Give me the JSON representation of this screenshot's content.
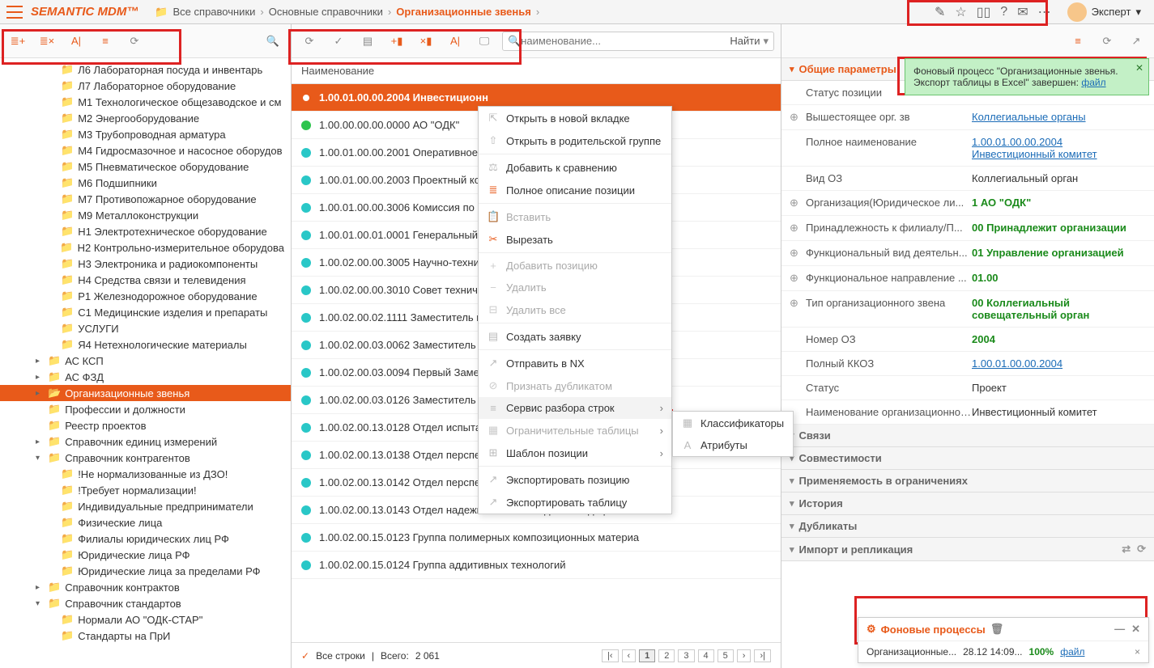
{
  "logo": "SEMANTIC MDM™",
  "breadcrumb": {
    "items": [
      "Все справочники",
      "Основные справочники",
      "Организационные звенья"
    ]
  },
  "user": {
    "name": "Эксперт"
  },
  "search": {
    "placeholder": "наименование...",
    "find": "Найти"
  },
  "tree": {
    "items": [
      {
        "lvl": 1,
        "label": "Л6 Лабораторная посуда и инвентарь"
      },
      {
        "lvl": 1,
        "label": "Л7 Лабораторное оборудование"
      },
      {
        "lvl": 1,
        "label": "М1 Технологическое общезаводское и см"
      },
      {
        "lvl": 1,
        "label": "М2 Энергооборудование"
      },
      {
        "lvl": 1,
        "label": "М3 Трубопроводная арматура"
      },
      {
        "lvl": 1,
        "label": "М4 Гидросмазочное и насосное оборудов"
      },
      {
        "lvl": 1,
        "label": "М5 Пневматическое оборудование"
      },
      {
        "lvl": 1,
        "label": "М6 Подшипники"
      },
      {
        "lvl": 1,
        "label": "М7 Противопожарное оборудование"
      },
      {
        "lvl": 1,
        "label": "М9 Металлоконструкции"
      },
      {
        "lvl": 1,
        "label": "Н1 Электротехническое оборудование"
      },
      {
        "lvl": 1,
        "label": "Н2 Контрольно-измерительное оборудова"
      },
      {
        "lvl": 1,
        "label": "Н3 Электроника и радиокомпоненты"
      },
      {
        "lvl": 1,
        "label": "Н4 Средства связи и телевидения"
      },
      {
        "lvl": 1,
        "label": "Р1 Железнодорожное оборудование"
      },
      {
        "lvl": 1,
        "label": "С1 Медицинские изделия и препараты"
      },
      {
        "lvl": 1,
        "label": "УСЛУГИ"
      },
      {
        "lvl": 1,
        "label": "Я4 Нетехнологические материалы"
      },
      {
        "lvl": 0,
        "label": "АС КСП",
        "arrow": true
      },
      {
        "lvl": 0,
        "label": "АС ФЗД",
        "arrow": true
      },
      {
        "lvl": 0,
        "label": "Организационные звенья",
        "arrow": true,
        "selected": true
      },
      {
        "lvl": 0,
        "label": "Профессии и должности"
      },
      {
        "lvl": 0,
        "label": "Реестр проектов"
      },
      {
        "lvl": 0,
        "label": "Справочник единиц измерений",
        "arrow": true
      },
      {
        "lvl": 0,
        "label": "Справочник контрагентов",
        "arrow": true,
        "open": true
      },
      {
        "lvl": 1,
        "label": "!Не нормализованные из ДЗО!"
      },
      {
        "lvl": 1,
        "label": "!Требует нормализации!"
      },
      {
        "lvl": 1,
        "label": "Индивидуальные предприниматели"
      },
      {
        "lvl": 1,
        "label": "Физические лица"
      },
      {
        "lvl": 1,
        "label": "Филиалы юридических лиц РФ"
      },
      {
        "lvl": 1,
        "label": "Юридические лица РФ"
      },
      {
        "lvl": 1,
        "label": "Юридические лица за пределами РФ"
      },
      {
        "lvl": 0,
        "label": "Справочник контрактов",
        "arrow": true
      },
      {
        "lvl": 0,
        "label": "Справочник стандартов",
        "arrow": true,
        "open": true
      },
      {
        "lvl": 1,
        "label": "Нормали АО \"ОДК-СТАР\""
      },
      {
        "lvl": 1,
        "label": "Стандарты на ПрИ"
      }
    ]
  },
  "list": {
    "header": "Наименование",
    "rows": [
      {
        "label": "1.00.01.00.00.2004 Инвестиционн",
        "selected": true
      },
      {
        "label": "1.00.00.00.00.0000 АО \"ОДК\"",
        "green": true
      },
      {
        "label": "1.00.01.00.00.2001 Оперативное с"
      },
      {
        "label": "1.00.01.00.00.2003 Проектный ко"
      },
      {
        "label": "1.00.01.00.00.3006 Комиссия по н"
      },
      {
        "label": "1.00.01.00.01.0001 Генеральный д"
      },
      {
        "label": "1.00.02.00.00.3005 Научно-технич"
      },
      {
        "label": "1.00.02.00.00.3010 Совет технич"
      },
      {
        "label": "1.00.02.00.02.1111 Заместитель ге"
      },
      {
        "label": "1.00.02.00.03.0062 Заместитель ге"
      },
      {
        "label": "1.00.02.00.03.0094 Первый Замес"
      },
      {
        "label": "1.00.02.00.03.0126 Заместитель"
      },
      {
        "label": "1.00.02.00.13.0128 Отдел испытан"
      },
      {
        "label": "1.00.02.00.13.0138 Отдел перспек"
      },
      {
        "label": "1.00.02.00.13.0142 Отдел перспек"
      },
      {
        "label": "1.00.02.00.13.0143 Отдел надежности и исследования дефектов"
      },
      {
        "label": "1.00.02.00.15.0123 Группа полимерных композиционных материа"
      },
      {
        "label": "1.00.02.00.15.0124 Группа аддитивных технологий"
      }
    ],
    "footer": {
      "allRows": "Все строки",
      "total_label": "Всего:",
      "total": "2 061"
    },
    "pages": [
      "1",
      "2",
      "3",
      "4",
      "5"
    ]
  },
  "ctx": {
    "items": [
      {
        "icon": "⇱",
        "label": "Открыть в новой вкладке"
      },
      {
        "icon": "⇧",
        "label": "Открыть в родительской группе"
      },
      {
        "sep": true
      },
      {
        "icon": "⚖",
        "label": "Добавить к сравнению"
      },
      {
        "icon": "≣",
        "label": "Полное описание позиции",
        "iconOrange": true
      },
      {
        "sep": true
      },
      {
        "icon": "📋",
        "label": "Вставить",
        "disabled": true
      },
      {
        "icon": "✂",
        "label": "Вырезать",
        "iconOrange": true
      },
      {
        "sep": true
      },
      {
        "icon": "+",
        "label": "Добавить позицию",
        "disabled": true
      },
      {
        "icon": "−",
        "label": "Удалить",
        "disabled": true
      },
      {
        "icon": "⊟",
        "label": "Удалить все",
        "disabled": true
      },
      {
        "sep": true
      },
      {
        "icon": "▤",
        "label": "Создать заявку"
      },
      {
        "sep": true
      },
      {
        "icon": "↗",
        "label": "Отправить в NX"
      },
      {
        "icon": "⊘",
        "label": "Признать дубликатом",
        "disabled": true
      },
      {
        "icon": "≡",
        "label": "Сервис разбора строк",
        "sub": true,
        "hl": true
      },
      {
        "icon": "▦",
        "label": "Ограничительные таблицы",
        "disabled": true,
        "sub": true
      },
      {
        "icon": "⊞",
        "label": "Шаблон позиции",
        "sub": true
      },
      {
        "sep": true
      },
      {
        "icon": "↗",
        "label": "Экспортировать позицию"
      },
      {
        "icon": "↗",
        "label": "Экспортировать таблицу"
      }
    ],
    "sub": [
      {
        "icon": "▦",
        "label": "Классификаторы"
      },
      {
        "icon": "A",
        "label": "Атрибуты"
      }
    ]
  },
  "right": {
    "header": "Общие параметры",
    "props": [
      {
        "plus": false,
        "lbl": "Статус позиции",
        "val": ""
      },
      {
        "plus": true,
        "lbl": "Вышестоящее орг. зв",
        "val": "Коллегиальные органы",
        "link": true
      },
      {
        "plus": false,
        "lbl": "Полное наименование",
        "val": "1.00.01.00.00.2004 Инвестиционный комитет",
        "link": true
      },
      {
        "plus": false,
        "lbl": "Вид ОЗ",
        "val": "Коллегиальный орган"
      },
      {
        "plus": true,
        "lbl": "Организация(Юридическое ли...",
        "val": "1 АО \"ОДК\"",
        "green": true
      },
      {
        "plus": true,
        "lbl": "Принадлежность к филиалу/П...",
        "val": "00 Принадлежит организации",
        "green": true
      },
      {
        "plus": true,
        "lbl": "Функциональный вид деятельн...",
        "val": "01 Управление организацией",
        "green": true
      },
      {
        "plus": true,
        "lbl": "Функциональное направление ...",
        "val": "01.00",
        "green": true
      },
      {
        "plus": true,
        "lbl": "Тип организационного звена",
        "val": "00 Коллегиальный совещательный орган",
        "green": true
      },
      {
        "plus": false,
        "lbl": "Номер ОЗ",
        "val": "2004",
        "green": true
      },
      {
        "plus": false,
        "lbl": "Полный ККОЗ",
        "val": "1.00.01.00.00.2004",
        "link": true
      },
      {
        "plus": false,
        "lbl": "Статус",
        "val": "Проект"
      },
      {
        "plus": false,
        "lbl": "Наименование организационного ...",
        "val": "Инвестиционный комитет"
      }
    ],
    "sections": [
      "Связи",
      "Совместимости",
      "Применяемость в ограничениях",
      "История",
      "Дубликаты",
      "Импорт и репликация"
    ]
  },
  "notif": {
    "text": "Фоновый процесс \"Организационные звенья. Экспорт таблицы в Excel\" завершен: ",
    "link": "файл"
  },
  "bgproc": {
    "title": "Фоновые процессы",
    "name": "Организационные...",
    "time": "28.12 14:09...",
    "pct": "100%",
    "link": "файл"
  }
}
